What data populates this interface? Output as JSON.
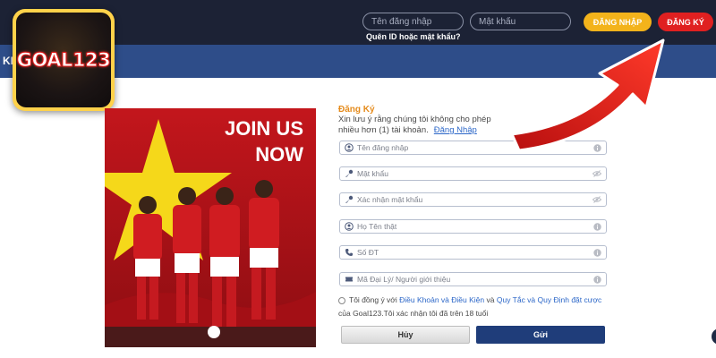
{
  "header": {
    "logo_text": "GOAL123",
    "username_placeholder": "Tên đăng nhập",
    "password_placeholder": "Mật khẩu",
    "forgot_label": "Quên ID hoặc mật khẩu?",
    "login_label": "ĐĂNG NHẬP",
    "register_label": "ĐĂNG KÝ",
    "nav_stub": "KI"
  },
  "banner": {
    "line1": "JOIN US",
    "line2": "NOW"
  },
  "form": {
    "title": "Đăng Ký",
    "desc": "Xin lưu ý rằng chúng tôi không cho phép",
    "desc_line2": "nhiều hơn (1) tài khoản.",
    "login_link": "Đăng Nhập",
    "fields": [
      {
        "placeholder": "Tên đăng nhập",
        "icon": "user-icon",
        "right_icon": "info-icon"
      },
      {
        "placeholder": "Mật khẩu",
        "icon": "key-icon",
        "right_icon": "eye-slash-icon"
      },
      {
        "placeholder": "Xác nhận mật khẩu",
        "icon": "key-icon",
        "right_icon": "eye-slash-icon"
      },
      {
        "placeholder": "Họ Tên thật",
        "icon": "user-icon",
        "right_icon": "info-icon"
      },
      {
        "placeholder": "Số ĐT",
        "icon": "phone-icon",
        "right_icon": "info-icon"
      },
      {
        "placeholder": "Mã Đại Lý/ Người giới thiệu",
        "icon": "ticket-icon",
        "right_icon": "info-icon"
      }
    ],
    "agree_prefix": "Tôi đồng ý với",
    "terms_link": "Điều Khoản và Điều Kiện",
    "agree_and": "và",
    "rules_link": "Quy Tắc và Quy Định đặt cược",
    "agree_suffix": "của Goal123.Tôi xác nhận tôi đã trên 18 tuổi",
    "cancel_label": "Hủy",
    "submit_label": "Gửi"
  },
  "colors": {
    "topbar": "#1c2235",
    "navbar": "#2e4d89",
    "login_button": "#f3b31b",
    "register_button": "#e02020",
    "form_title": "#e58b1c",
    "submit_button": "#1f3d7a",
    "arrow": "#e41d1d"
  }
}
